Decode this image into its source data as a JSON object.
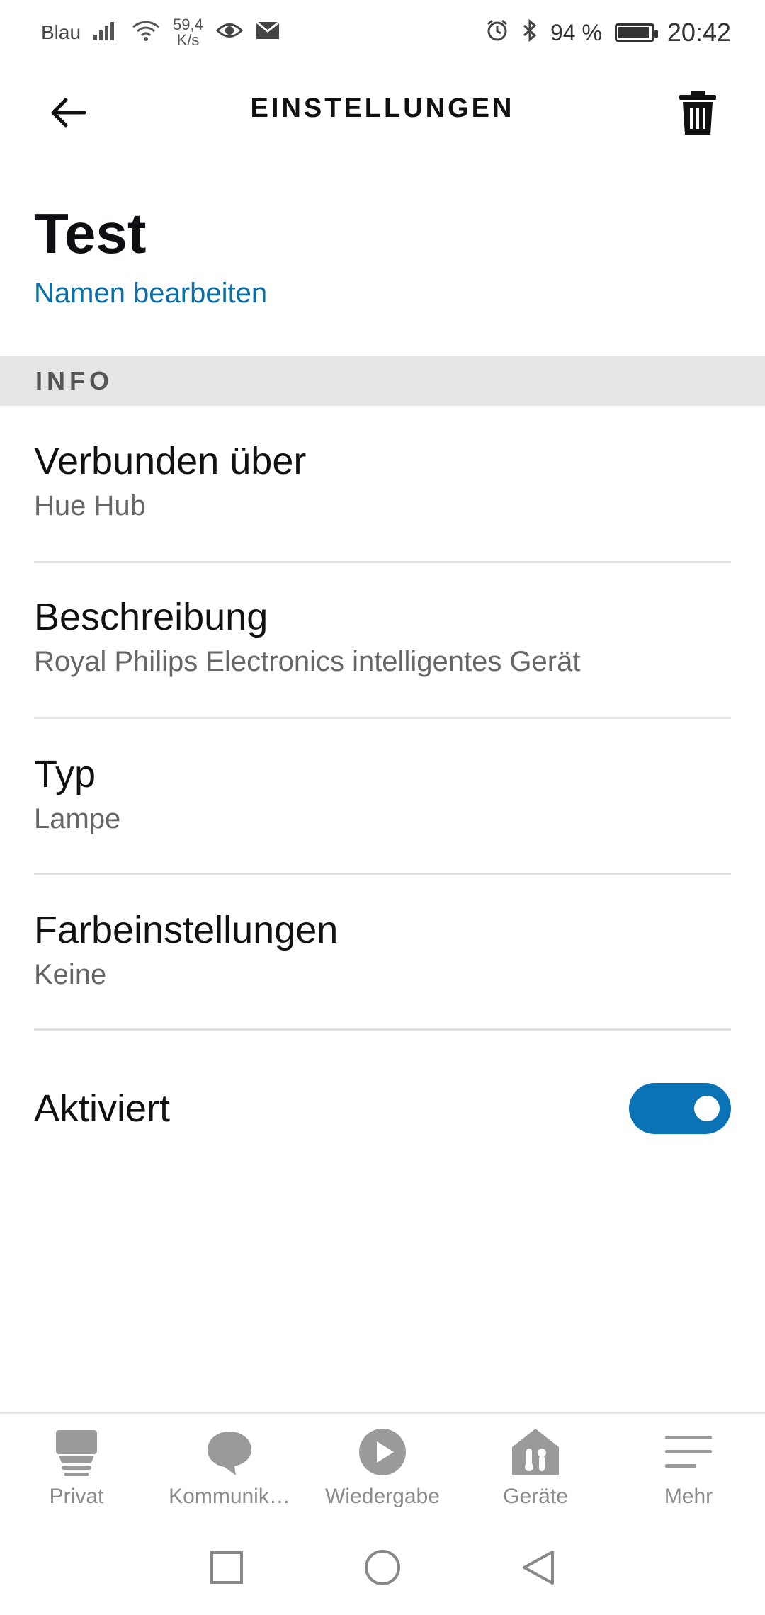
{
  "status_bar": {
    "carrier": "Blau",
    "speed_top": "59,4",
    "speed_bottom": "K/s",
    "battery": "94 %",
    "time": "20:42"
  },
  "header": {
    "title": "EINSTELLUNGEN"
  },
  "device": {
    "name": "Test",
    "edit_label": "Namen bearbeiten"
  },
  "section": {
    "title": "INFO"
  },
  "rows": [
    {
      "label": "Verbunden über",
      "value": "Hue Hub"
    },
    {
      "label": "Beschreibung",
      "value": "Royal Philips Electronics intelligentes Gerät"
    },
    {
      "label": "Typ",
      "value": "Lampe"
    },
    {
      "label": "Farbeinstellungen",
      "value": "Keine"
    }
  ],
  "toggle": {
    "label": "Aktiviert",
    "on": true
  },
  "bottom_nav": [
    {
      "label": "Privat",
      "icon": "home-device-icon"
    },
    {
      "label": "Kommunik…",
      "icon": "speech-bubble-icon"
    },
    {
      "label": "Wiedergabe",
      "icon": "play-icon"
    },
    {
      "label": "Geräte",
      "icon": "smart-home-icon"
    },
    {
      "label": "Mehr",
      "icon": "menu-icon"
    }
  ],
  "colors": {
    "accent": "#0a73b6",
    "link": "#0a6fa8",
    "nav_gray": "#8a8a8a"
  }
}
